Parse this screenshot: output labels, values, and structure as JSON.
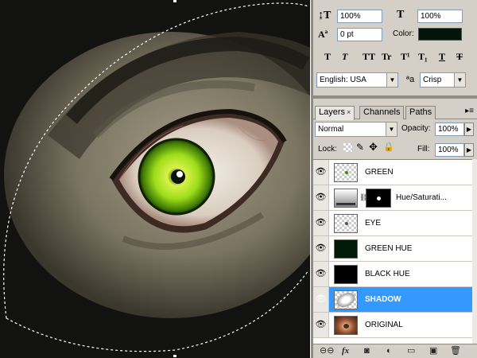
{
  "character": {
    "vertical_scale": "100%",
    "horizontal_scale": "100%",
    "baseline_shift": "0 pt",
    "color_label": "Color:",
    "color_swatch": "#03150a",
    "format_buttons": [
      "T",
      "T",
      "TT",
      "Tr",
      "T¹",
      "T₁",
      "T",
      "T"
    ],
    "language": "English: USA",
    "aa_label": "ªa",
    "antialias": "Crisp"
  },
  "tabs": [
    {
      "label": "Layers",
      "close": "×"
    },
    {
      "label": "Channels"
    },
    {
      "label": "Paths"
    }
  ],
  "blend": {
    "mode": "Normal",
    "opacity_label": "Opacity:",
    "opacity": "100%",
    "lock_label": "Lock:",
    "fill_label": "Fill:",
    "fill": "100%"
  },
  "layers": [
    {
      "name": "GREEN",
      "thumb": "checker-green-dot",
      "selected": false
    },
    {
      "name": "Hue/Saturati...",
      "thumb": "adjustment",
      "selected": false
    },
    {
      "name": "EYE",
      "thumb": "checker-dot",
      "selected": false
    },
    {
      "name": "GREEN HUE",
      "thumb": "dark-green",
      "selected": false
    },
    {
      "name": "BLACK HUE",
      "thumb": "black",
      "selected": false
    },
    {
      "name": "SHADOW",
      "thumb": "shadow",
      "selected": true
    },
    {
      "name": "ORIGINAL",
      "thumb": "photo",
      "selected": false
    }
  ],
  "colors": {
    "selection": "#3399ff",
    "iris": "#9ddd1a",
    "green_hue": "#021a08"
  },
  "footer_icons": [
    "link-icon",
    "fx-icon",
    "mask-icon",
    "adjustment-icon",
    "group-icon",
    "new-layer-icon",
    "trash-icon"
  ]
}
